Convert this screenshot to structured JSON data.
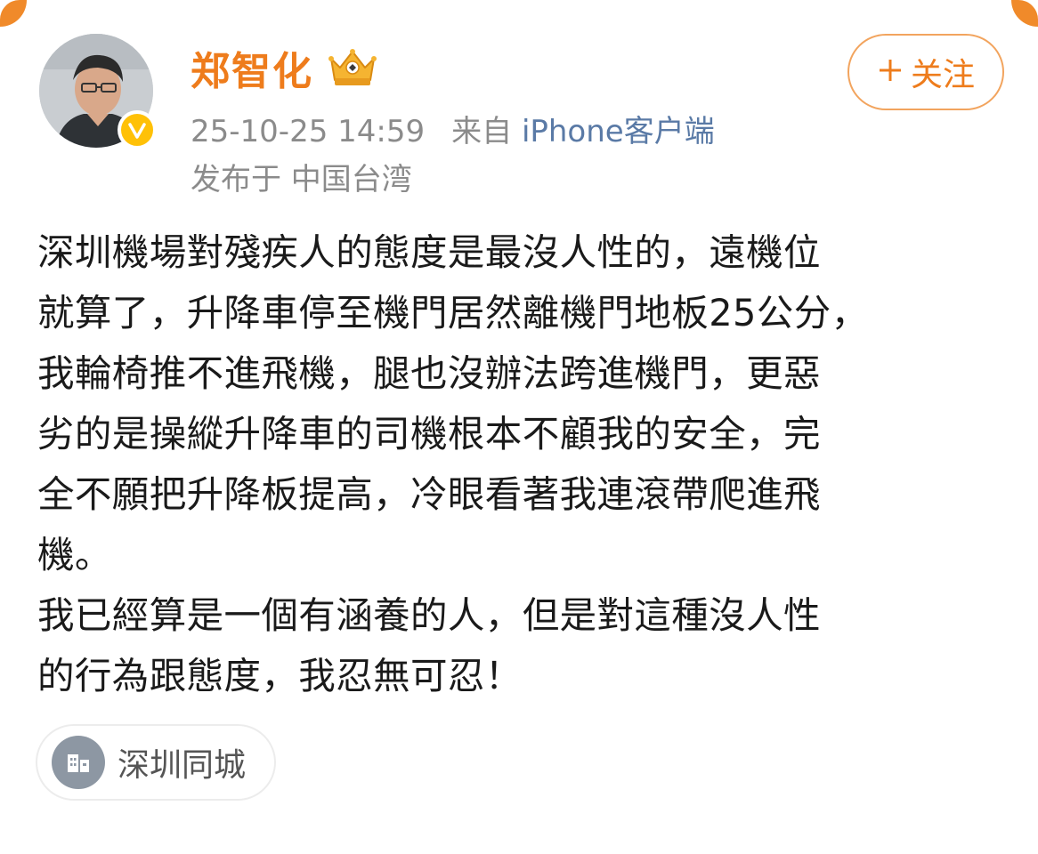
{
  "post": {
    "author": {
      "name": "郑智化",
      "verified": true,
      "badge": "crown-badge-icon"
    },
    "timestamp": "25-10-25 14:59",
    "from_label": "来自",
    "source": "iPhone客户端",
    "location": "发布于 中国台湾",
    "follow_button": {
      "label": "关注",
      "icon": "plus-icon"
    },
    "content_lines": [
      "深圳機場對殘疾人的態度是最沒人性的，遠機位",
      "就算了，升降車停至機門居然離機門地板25公分，",
      "我輪椅推不進飛機，腿也沒辦法跨進機門，更惡",
      "劣的是操縱升降車的司機根本不顧我的安全，完",
      "全不願把升降板提高，冷眼看著我連滾帶爬進飛",
      "機。",
      "我已經算是一個有涵養的人，但是對這種沒人性",
      "的行為跟態度，我忍無可忍！"
    ],
    "topic_tag": {
      "label": "深圳同城",
      "icon": "city-building-icon"
    }
  },
  "colors": {
    "accent": "#ee7c1c",
    "meta_gray": "#8b8b8b",
    "source_blue": "#5a7aa6",
    "text": "#1a1a1a",
    "verified_yellow": "#ffc107",
    "tag_icon_gray": "#8d97a3"
  }
}
